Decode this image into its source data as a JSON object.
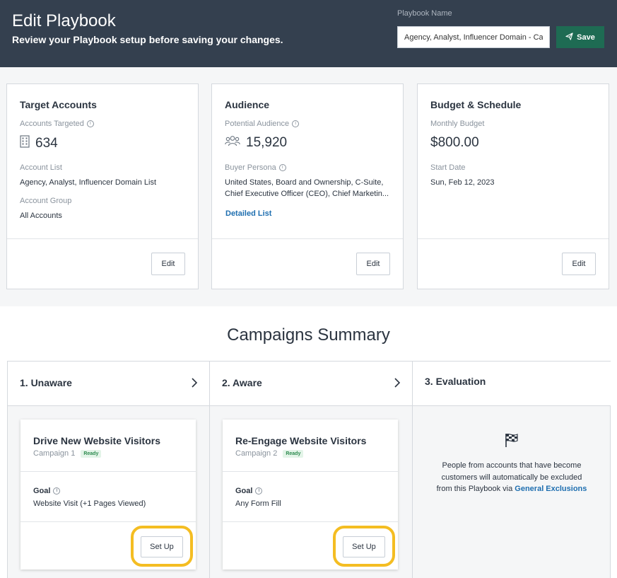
{
  "header": {
    "title": "Edit Playbook",
    "subtitle": "Review your Playbook setup before saving your changes.",
    "playbook_name_label": "Playbook Name",
    "playbook_name_value": "Agency, Analyst, Influencer Domain - Cas",
    "save_label": "Save"
  },
  "cards": {
    "target": {
      "title": "Target Accounts",
      "accounts_label": "Accounts Targeted",
      "accounts_value": "634",
      "list_label": "Account List",
      "list_value": "Agency, Analyst, Influencer Domain List",
      "group_label": "Account Group",
      "group_value": "All Accounts",
      "edit_label": "Edit"
    },
    "audience": {
      "title": "Audience",
      "potential_label": "Potential Audience",
      "potential_value": "15,920",
      "persona_label": "Buyer Persona",
      "persona_line1": "United States, Board and Ownership, C-Suite,",
      "persona_line2": "Chief Executive Officer (CEO), Chief Marketin...",
      "detailed_link": "Detailed List",
      "edit_label": "Edit"
    },
    "budget": {
      "title": "Budget & Schedule",
      "monthly_label": "Monthly Budget",
      "monthly_value": "$800.00",
      "start_label": "Start Date",
      "start_value": "Sun, Feb 12, 2023",
      "edit_label": "Edit"
    }
  },
  "summary": {
    "title": "Campaigns Summary",
    "stages": [
      {
        "name": "1. Unaware",
        "campaign": {
          "name": "Drive New Website Visitors",
          "number": "Campaign 1",
          "status": "Ready",
          "goal_label": "Goal",
          "goal_value": "Website Visit (+1 Pages Viewed)",
          "setup_label": "Set Up"
        }
      },
      {
        "name": "2. Aware",
        "campaign": {
          "name": "Re-Engage Website Visitors",
          "number": "Campaign 2",
          "status": "Ready",
          "goal_label": "Goal",
          "goal_value": "Any Form Fill",
          "setup_label": "Set Up"
        }
      },
      {
        "name": "3. Evaluation",
        "text": "People from accounts that have become customers will automatically be excluded from this Playbook via",
        "link": "General Exclusions"
      }
    ]
  },
  "colors": {
    "header_bg": "#34404f",
    "save_bg": "#1e6b53",
    "link": "#1f6fb0",
    "highlight_ring": "#f4bd22",
    "ready_badge": "#2e8b4f"
  },
  "icons": {
    "save": "paper-plane-icon",
    "accounts": "building-icon",
    "audience": "people-icon",
    "info": "info-icon",
    "chevron": "chevron-right-icon",
    "evaluation": "checkered-flag-icon"
  }
}
